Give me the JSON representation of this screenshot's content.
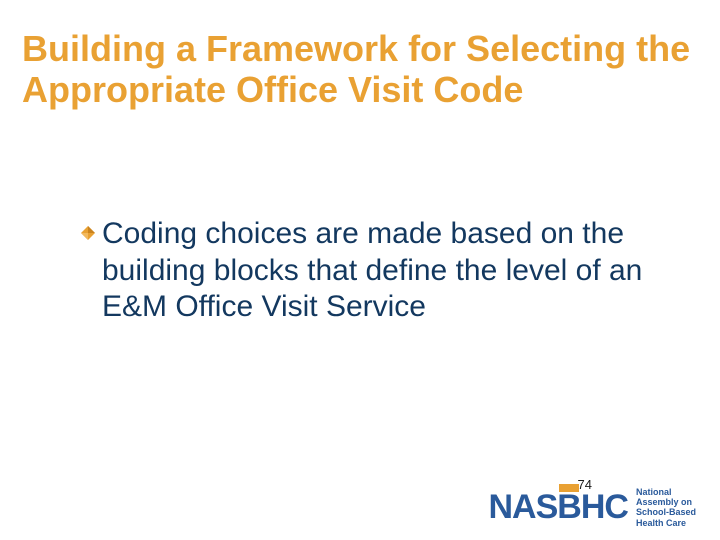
{
  "title": "Building a Framework for Selecting the Appropriate Office Visit Code",
  "bullet": {
    "icon_name": "diamond-bullet-icon",
    "text": "Coding choices are made based on the building blocks that define the level of an E&M Office Visit Service"
  },
  "page_number": "74",
  "logo": {
    "word": "NASBHC",
    "tagline_line1": "National",
    "tagline_line2": "Assembly on",
    "tagline_line3": "School-Based",
    "tagline_line4": "Health Care"
  },
  "colors": {
    "title": "#e9a133",
    "body_text": "#13385f",
    "logo_blue": "#2a5a9b",
    "logo_accent": "#e9a133"
  }
}
